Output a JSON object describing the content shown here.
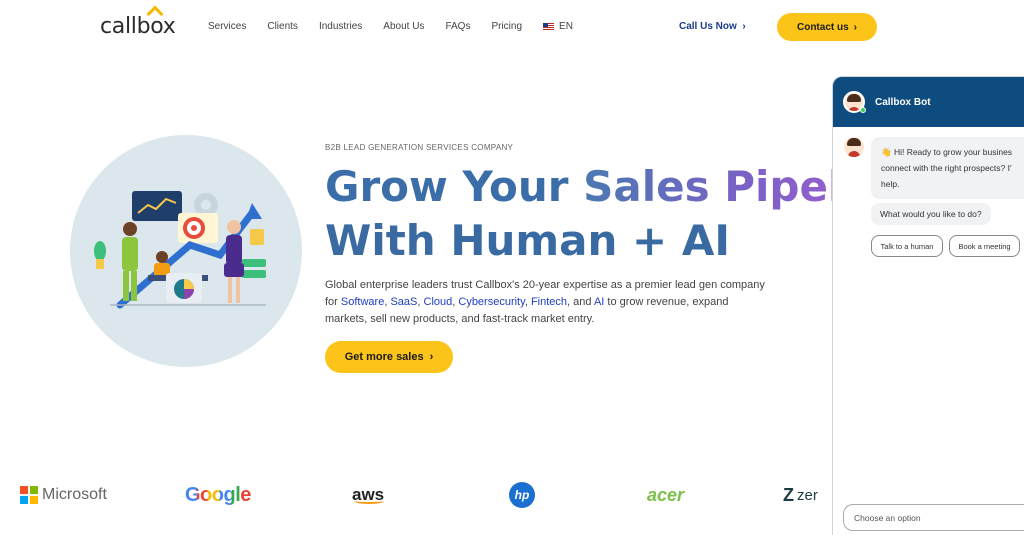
{
  "brand": {
    "logo_text": "callbox"
  },
  "nav": {
    "items": [
      "Services",
      "Clients",
      "Industries",
      "About Us",
      "FAQs",
      "Pricing"
    ],
    "lang": "EN",
    "call_label": "Call Us Now",
    "contact_label": "Contact us"
  },
  "hero": {
    "eyebrow": "B2B LEAD GENERATION SERVICES COMPANY",
    "headline_line1_a": "Grow Your",
    "headline_line1_b": "Sales Pipeli",
    "headline_line2": "With Human + AI",
    "desc_1": "Global enterprise leaders trust Callbox's 20-year expertise as a premier lead gen company for ",
    "links": [
      "Software",
      "SaaS",
      "Cloud",
      "Cybersecurity",
      "Fintech",
      "AI"
    ],
    "desc_2": " to grow revenue, expand markets, sell new products, and fast-track market entry.",
    "cta_label": "Get more sales"
  },
  "logos": {
    "microsoft": "Microsoft",
    "google": "Google",
    "aws": "aws",
    "hp": "hp",
    "acer": "acer",
    "zendesk": "zer"
  },
  "chat": {
    "title": "Callbox Bot",
    "greeting_line1": "👋 Hi! Ready to grow your busines",
    "greeting_line2": "connect with the right prospects? I'",
    "greeting_line3": "help.",
    "question": "What would you like to do?",
    "options": [
      "Talk to a human",
      "Book a meeting"
    ],
    "input_placeholder": "Choose an option"
  },
  "colors": {
    "accent_yellow": "#fcc419",
    "nav_blue": "#1b3c8a",
    "chat_header": "#0e4b7f",
    "hero_circle": "#dbe7ec"
  }
}
